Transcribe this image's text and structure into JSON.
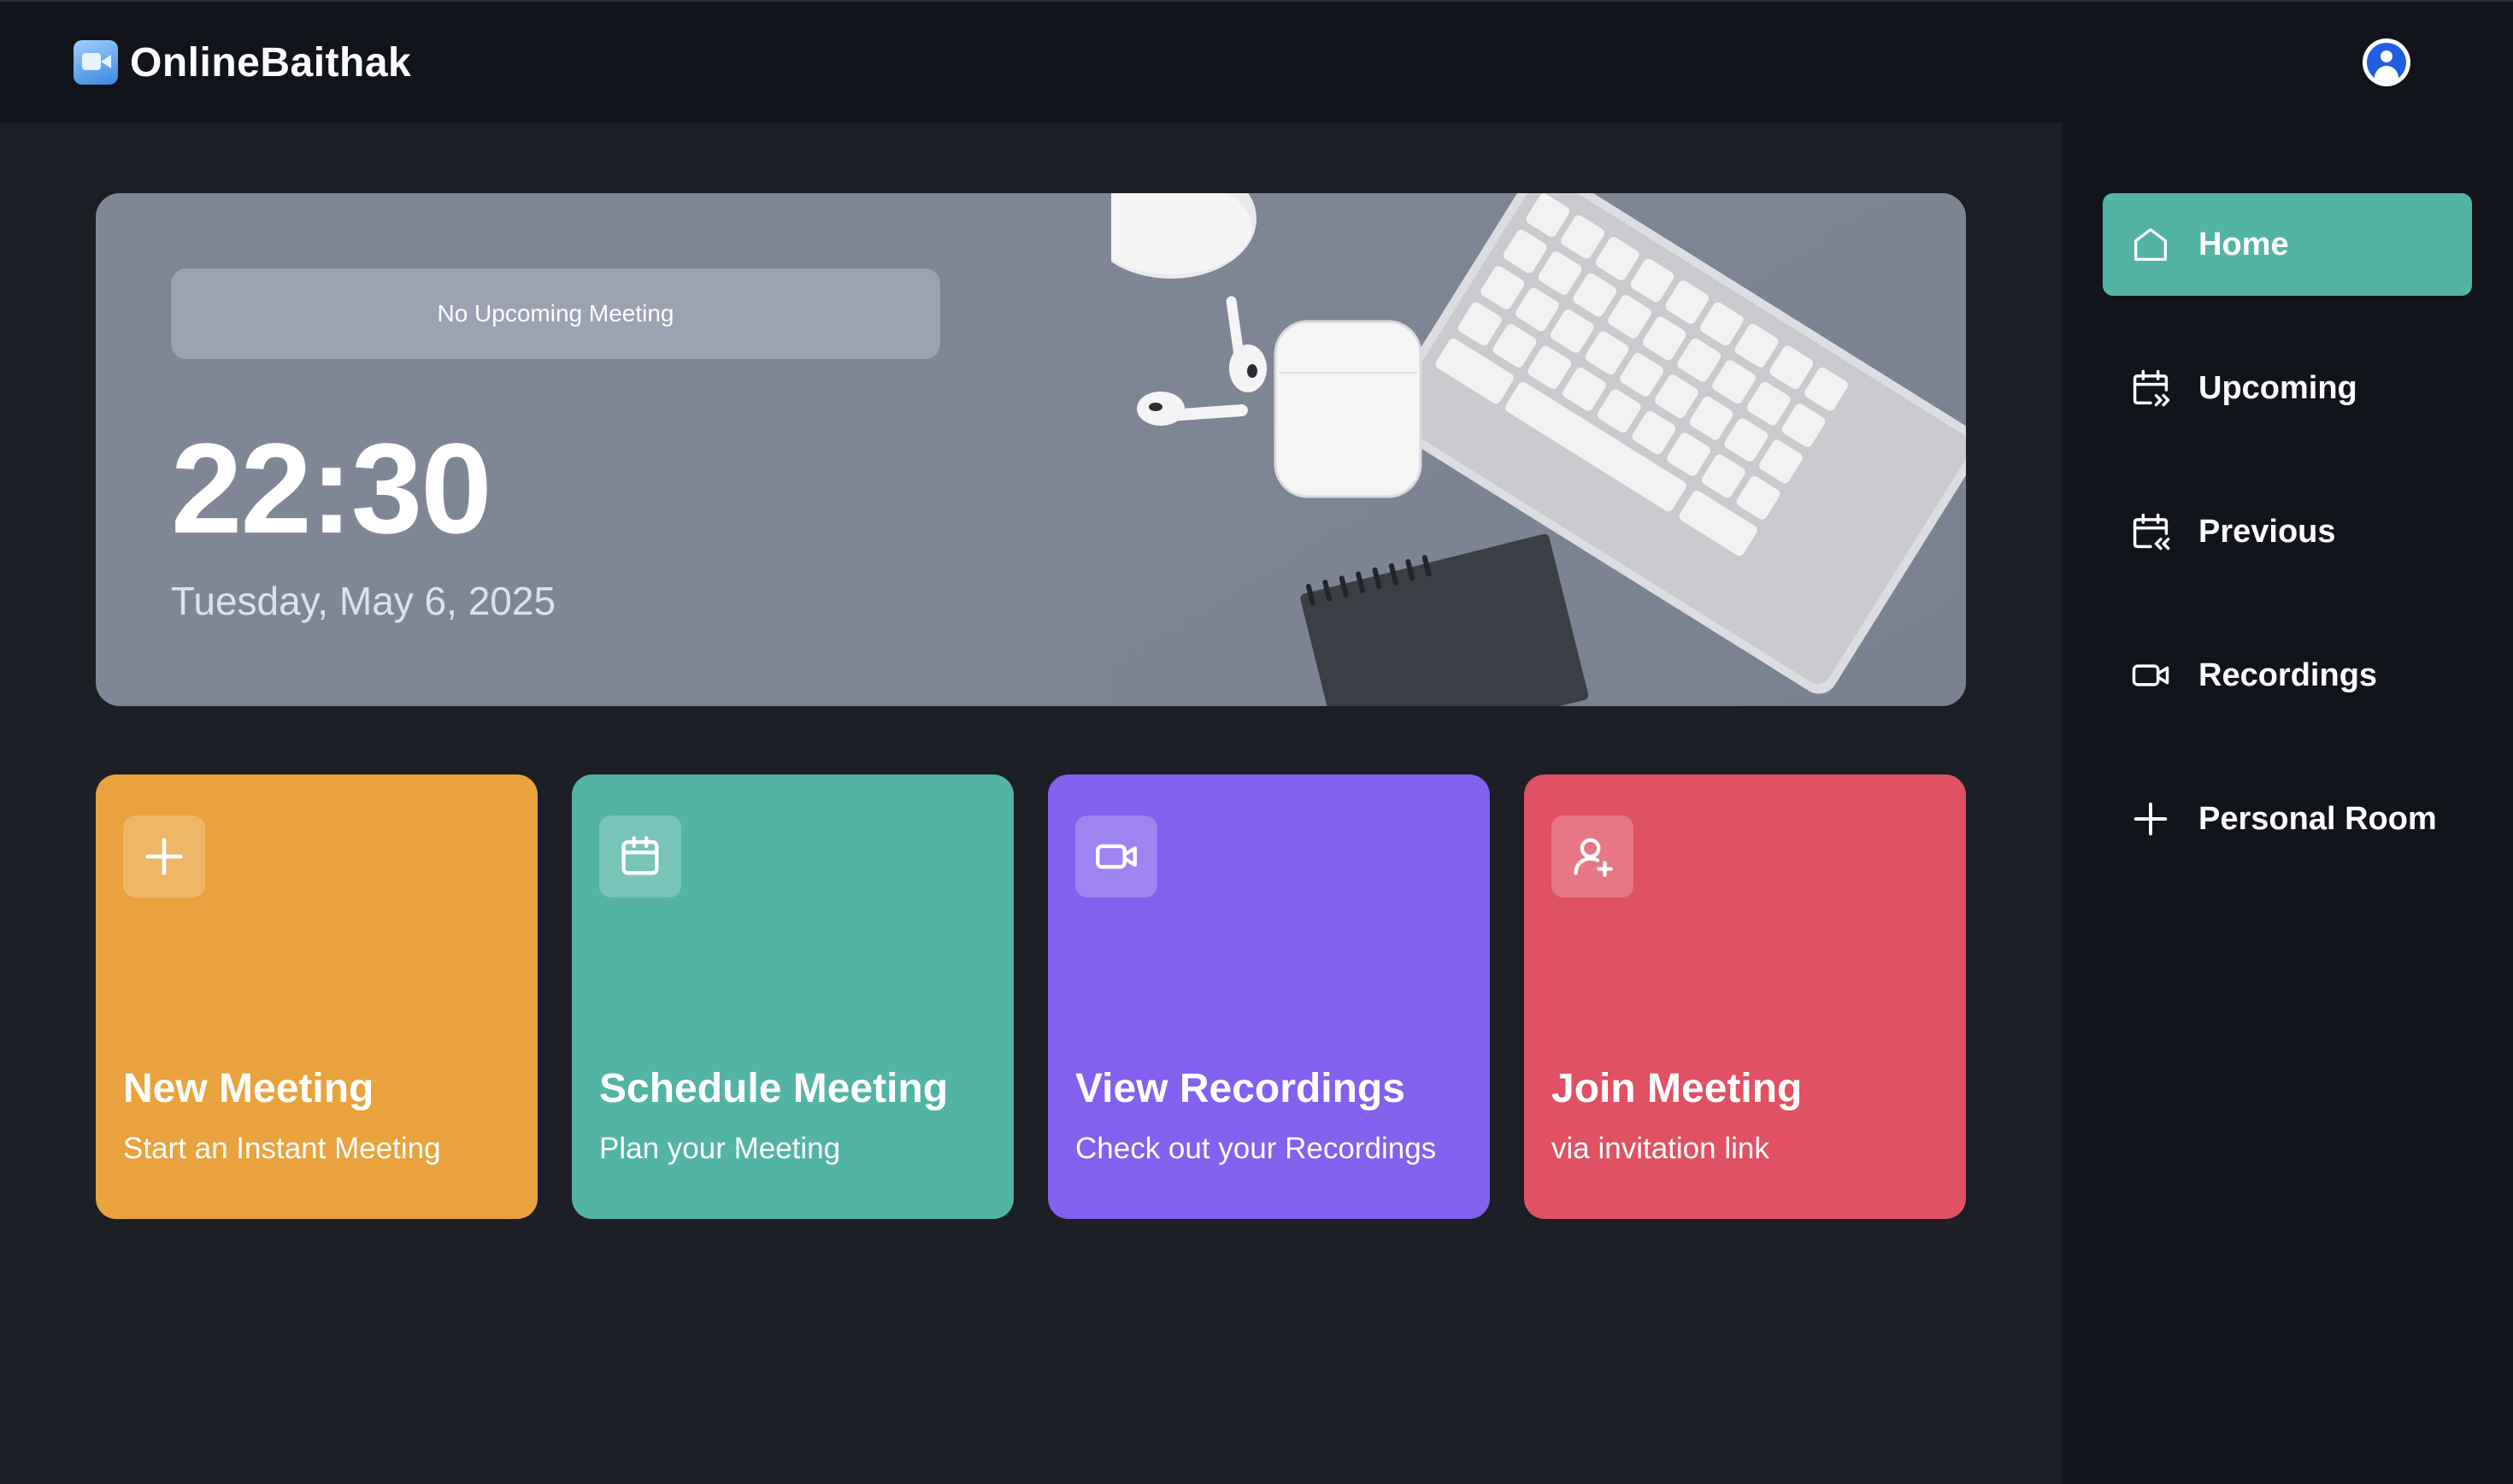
{
  "app": {
    "name": "OnlineBaithak"
  },
  "sidebar": {
    "items": [
      {
        "label": "Home",
        "icon": "home-icon",
        "active": true
      },
      {
        "label": "Upcoming",
        "icon": "calendar-forward-icon",
        "active": false
      },
      {
        "label": "Previous",
        "icon": "calendar-back-icon",
        "active": false
      },
      {
        "label": "Recordings",
        "icon": "video-icon",
        "active": false
      },
      {
        "label": "Personal Room",
        "icon": "plus-icon",
        "active": false
      }
    ]
  },
  "hero": {
    "banner": "No Upcoming Meeting",
    "time": "22:30",
    "date": "Tuesday, May 6, 2025"
  },
  "cards": [
    {
      "title": "New Meeting",
      "subtitle": "Start an Instant Meeting",
      "icon": "plus-icon",
      "color": "#e9a23d"
    },
    {
      "title": "Schedule Meeting",
      "subtitle": "Plan your Meeting",
      "icon": "calendar-icon",
      "color": "#53b4a5"
    },
    {
      "title": "View Recordings",
      "subtitle": "Check out your Recordings",
      "icon": "video-icon",
      "color": "#8360ee"
    },
    {
      "title": "Join Meeting",
      "subtitle": "via invitation link",
      "icon": "user-plus-icon",
      "color": "#e05163"
    }
  ],
  "colors": {
    "accent": "#53b4a5",
    "background": "#1c1f25",
    "topbar": "#11141a"
  }
}
